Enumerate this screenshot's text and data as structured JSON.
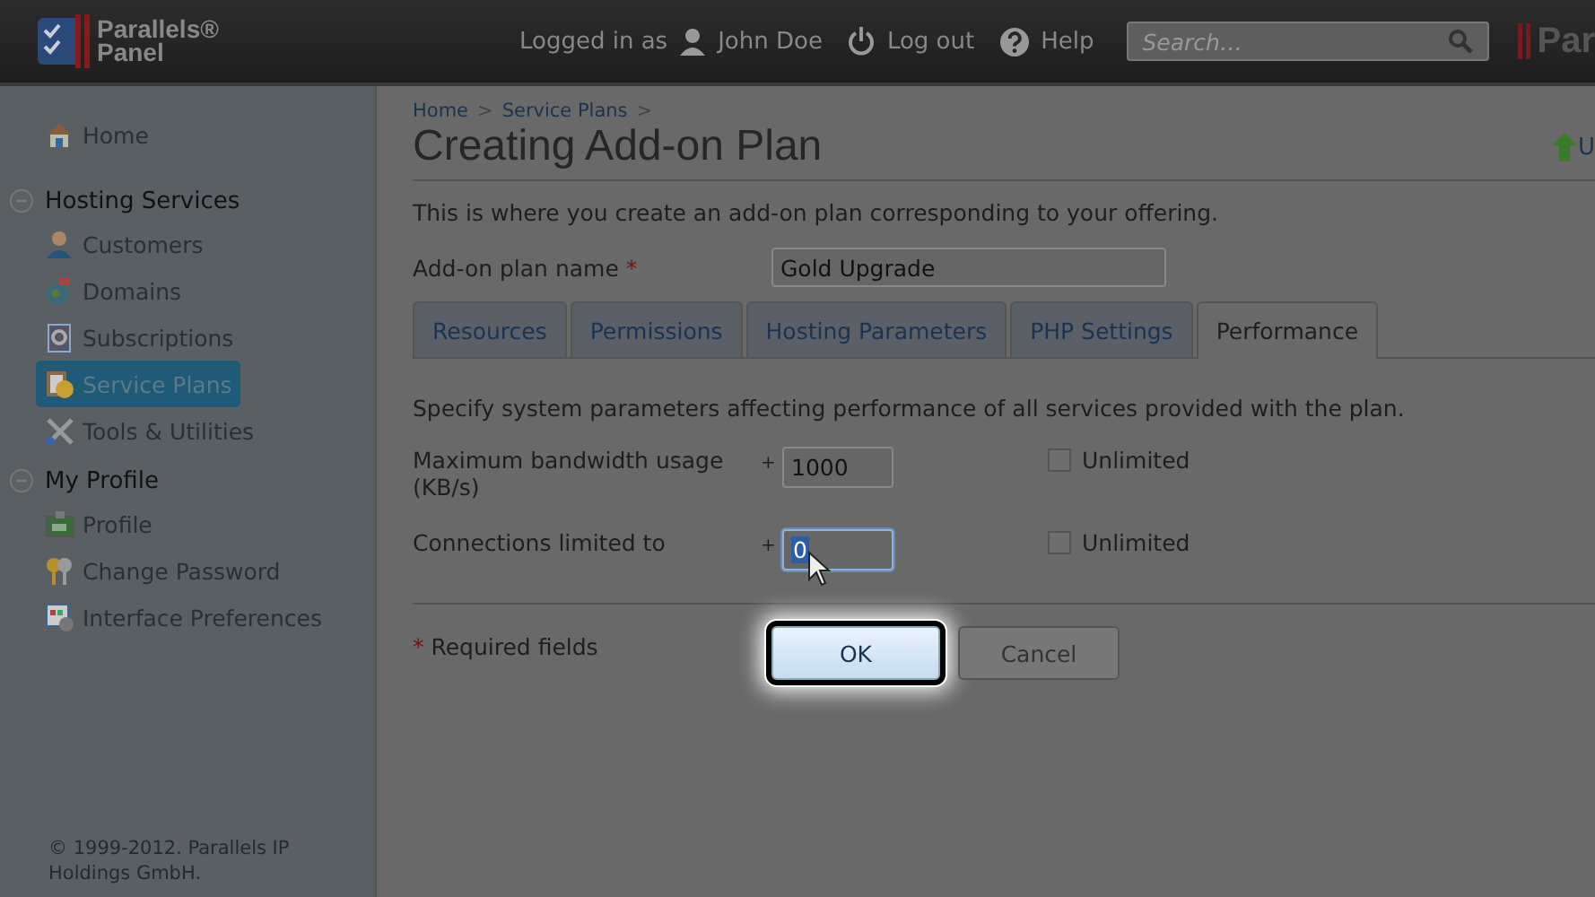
{
  "header": {
    "logo": [
      "Parallels®",
      "Panel"
    ],
    "logged_in_label": "Logged in as",
    "user": "John Doe",
    "logout": "Log out",
    "help": "Help",
    "search": {
      "placeholder": "Search…"
    },
    "brand_fragment": "Par"
  },
  "sidebar": {
    "items": [
      {
        "kind": "link",
        "label": "Home",
        "selected": false
      },
      {
        "kind": "section",
        "label": "Hosting Services",
        "expanded": true,
        "children": [
          {
            "label": "Customers",
            "selected": false
          },
          {
            "label": "Domains",
            "selected": false
          },
          {
            "label": "Subscriptions",
            "selected": false
          },
          {
            "label": "Service Plans",
            "selected": true
          },
          {
            "label": "Tools & Utilities",
            "selected": false
          }
        ]
      },
      {
        "kind": "section",
        "label": "My Profile",
        "expanded": true,
        "children": [
          {
            "label": "Profile",
            "selected": false
          },
          {
            "label": "Change Password",
            "selected": false
          },
          {
            "label": "Interface Preferences",
            "selected": false
          }
        ]
      }
    ],
    "copyright": "© 1999-2012. Parallels IP Holdings GmbH."
  },
  "main": {
    "breadcrumbs": [
      "Home",
      "Service Plans"
    ],
    "separator": ">",
    "title": "Creating Add-on Plan",
    "side_link": "U",
    "intro": "This is where you create an add-on plan corresponding to your offering.",
    "plan_name": {
      "label": "Add-on plan name",
      "required_mark": "*",
      "value": "Gold Upgrade"
    },
    "tabs": [
      {
        "label": "Resources",
        "selected": false
      },
      {
        "label": "Permissions",
        "selected": false
      },
      {
        "label": "Hosting Parameters",
        "selected": false
      },
      {
        "label": "PHP Settings",
        "selected": false
      },
      {
        "label": "Performance",
        "selected": true
      }
    ],
    "tab_intro": "Specify system parameters affecting performance of all services provided with the plan.",
    "fields": [
      {
        "label": "Maximum bandwidth usage (KB/s)",
        "prefix": "+",
        "value": "1000",
        "text_selected": false,
        "unlimited_label": "Unlimited",
        "unlimited": false
      },
      {
        "label": "Connections limited to",
        "prefix": "+",
        "value": "0",
        "text_selected": true,
        "unlimited_label": "Unlimited",
        "unlimited": false
      }
    ],
    "required_note": {
      "mark": "*",
      "text": "Required fields"
    },
    "buttons": [
      {
        "label": "OK",
        "highlighted": true
      },
      {
        "label": "Cancel",
        "highlighted": false
      }
    ]
  }
}
